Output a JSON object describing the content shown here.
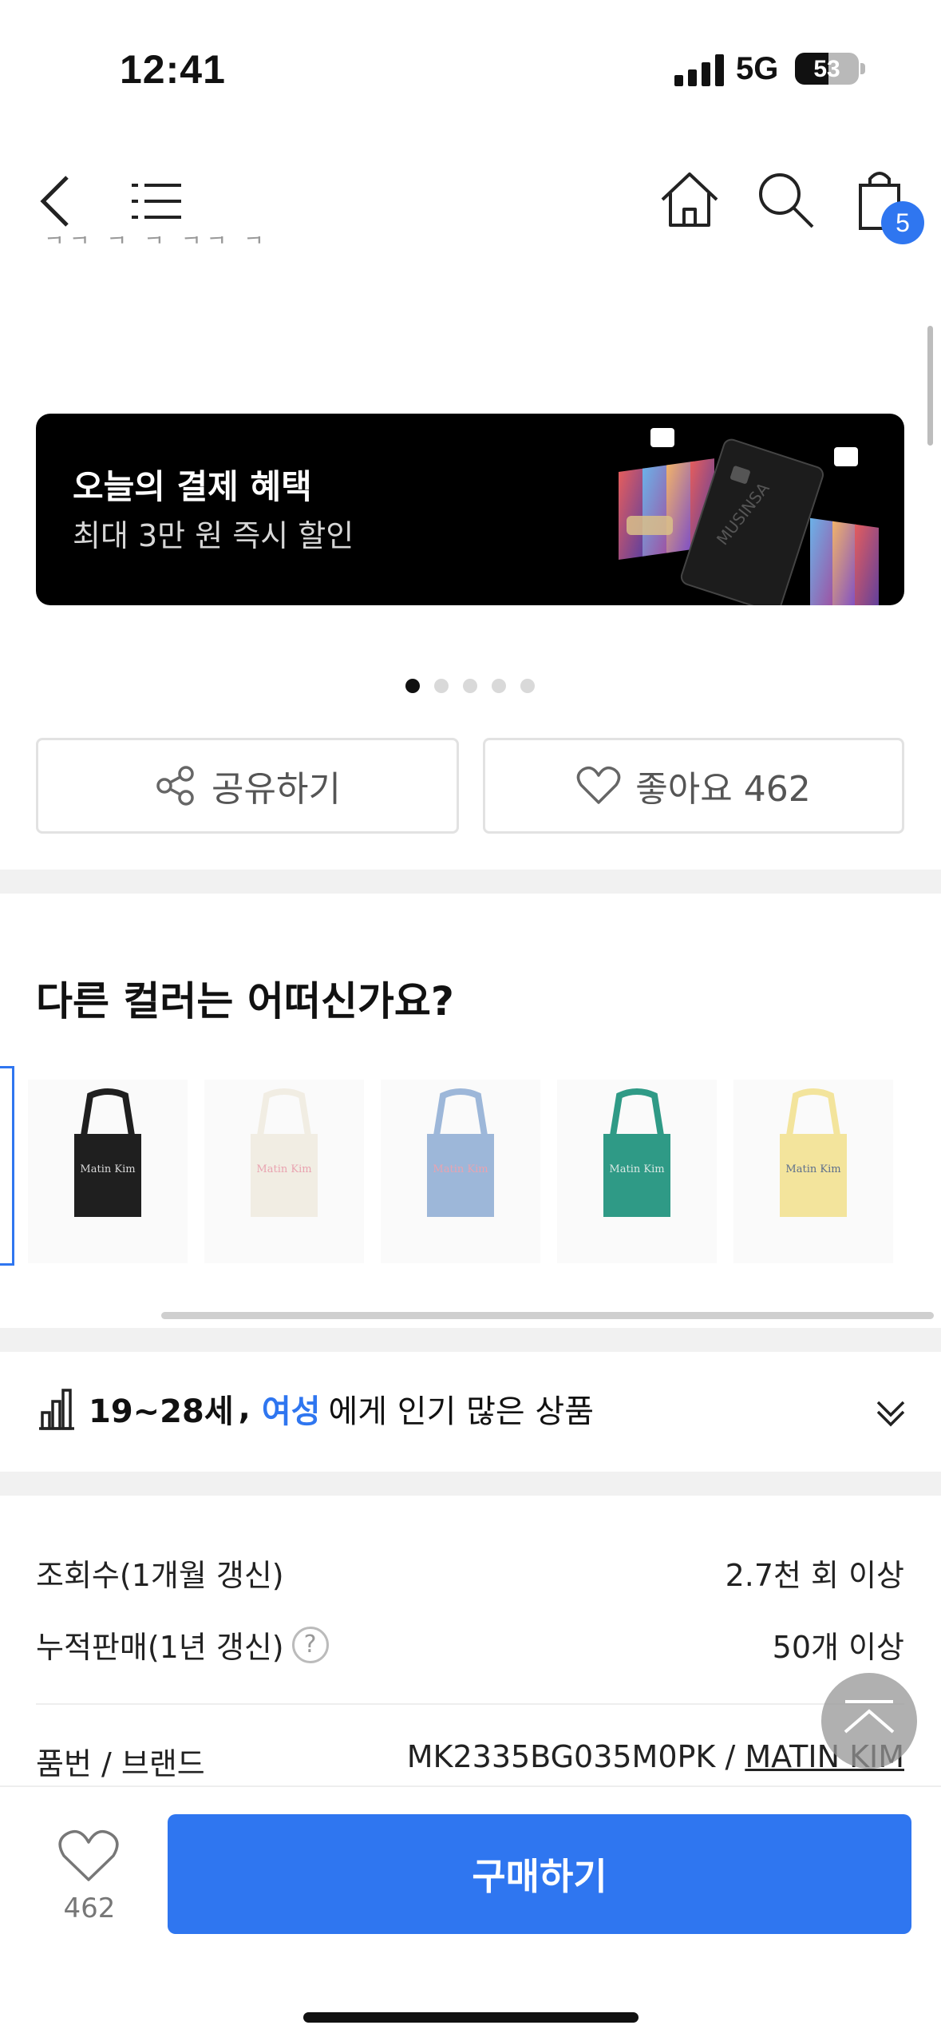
{
  "status_bar": {
    "time": "12:41",
    "network": "5G",
    "battery": "53",
    "battery_level_percent": 53
  },
  "header": {
    "back_icon": "chevron-left-icon",
    "menu_icon": "list-icon",
    "home_icon": "home-icon",
    "search_icon": "search-icon",
    "cart_icon": "shopping-bag-icon",
    "cart_count": "5"
  },
  "banner": {
    "title": "오늘의 결제 혜택",
    "subtitle": "최대 3만 원 즉시 할인",
    "card_text": "MUSINSA",
    "page_count": 5,
    "active_page": 1
  },
  "actions": {
    "share_label": "공유하기",
    "like_label": "좋아요 462",
    "share_icon": "share-icon",
    "like_icon": "heart-icon"
  },
  "colors_section": {
    "title": "다른 컬러는 어떠신가요?",
    "swatches": [
      {
        "color": "#1f1f1f",
        "label": "Matin Kim",
        "label_color": "#d8d8d8"
      },
      {
        "color": "#f1ede3",
        "label": "Matin Kim",
        "label_color": "#e9a3b0"
      },
      {
        "color": "#9db7d9",
        "label": "Matin Kim",
        "label_color": "#e9a3b0"
      },
      {
        "color": "#2f9a86",
        "label": "Matin Kim",
        "label_color": "#d8e8e3"
      },
      {
        "color": "#f3e49c",
        "label": "Matin Kim",
        "label_color": "#5d6f8c"
      }
    ]
  },
  "popular": {
    "age": "19~28세",
    "comma": ",",
    "gender": "여성",
    "suffix": "에게 인기 많은 상품",
    "icon": "bar-chart-icon",
    "expand_icon": "double-chevron-down-icon"
  },
  "info": {
    "views_label": "조회수(1개월 갱신)",
    "views_value": "2.7천 회 이상",
    "sales_label": "누적판매(1년 갱신)",
    "sales_help": "?",
    "sales_value": "50개 이상",
    "sku_label": "품번 / 브랜드",
    "sku_value": "MK2335BG035M0PK",
    "sku_sep": " / ",
    "brand": "MATIN KIM"
  },
  "bottom": {
    "favorite_count": "462",
    "buy_label": "구매하기"
  },
  "accent": "#2f76f0"
}
